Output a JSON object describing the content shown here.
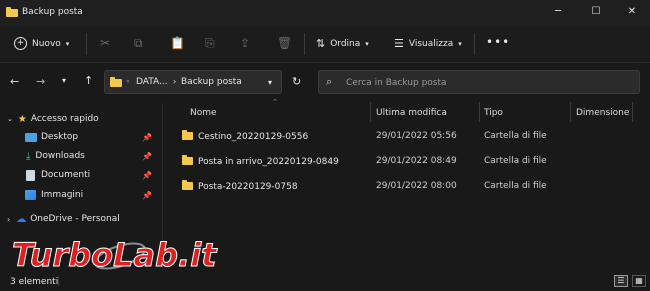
{
  "window": {
    "title": "Backup posta"
  },
  "toolbar": {
    "new_label": "Nuovo",
    "sort_label": "Ordina",
    "view_label": "Visualizza"
  },
  "address": {
    "segments": [
      "DATA...",
      "Backup posta"
    ],
    "search_placeholder": "Cerca in Backup posta"
  },
  "sidebar": {
    "items": [
      {
        "label": "Accesso rapido",
        "icon": "star-icon"
      },
      {
        "label": "Desktop",
        "icon": "desktop-icon"
      },
      {
        "label": "Downloads",
        "icon": "download-icon"
      },
      {
        "label": "Documenti",
        "icon": "document-icon"
      },
      {
        "label": "Immagini",
        "icon": "image-icon"
      },
      {
        "label": "OneDrive - Personal",
        "icon": "cloud-icon"
      }
    ]
  },
  "columns": [
    "Nome",
    "Ultima modifica",
    "Tipo",
    "Dimensione"
  ],
  "files": [
    {
      "name": "Cestino_20220129-0556",
      "modified": "29/01/2022 05:56",
      "type": "Cartella di file"
    },
    {
      "name": "Posta in arrivo_20220129-0849",
      "modified": "29/01/2022 08:49",
      "type": "Cartella di file"
    },
    {
      "name": "Posta-20220129-0758",
      "modified": "29/01/2022 08:00",
      "type": "Cartella di file"
    }
  ],
  "status": {
    "count": "3 elementi"
  },
  "watermark": "TurboLab.it",
  "colors": {
    "accent": "#2f80ed",
    "folder": "#f2c94c",
    "logo_red": "#e02020"
  }
}
